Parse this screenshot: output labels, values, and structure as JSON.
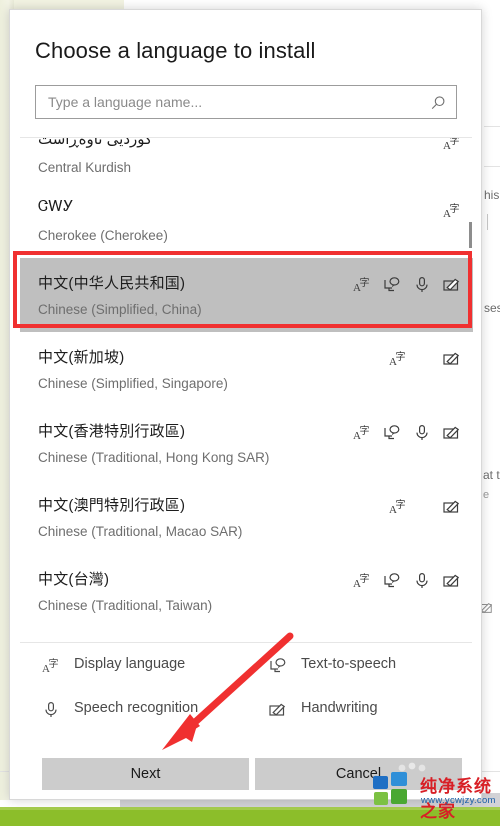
{
  "dialog": {
    "title": "Choose a language to install",
    "search": {
      "placeholder": "Type a language name...",
      "value": "",
      "icon": "search-icon"
    },
    "buttons": {
      "next": "Next",
      "cancel": "Cancel"
    }
  },
  "list": {
    "items": [
      {
        "native": "کوردیی ناوەڕاست",
        "english": "Central Kurdish",
        "features": [
          "display"
        ],
        "selected": false,
        "clipped": true
      },
      {
        "native": "ᏣᎳᎩ",
        "english": "Cherokee (Cherokee)",
        "features": [
          "display"
        ],
        "selected": false,
        "clipped": false
      },
      {
        "native": "中文(中华人民共和国)",
        "english": "Chinese (Simplified, China)",
        "features": [
          "display",
          "tts",
          "speech",
          "handwriting"
        ],
        "selected": true,
        "clipped": false
      },
      {
        "native": "中文(新加坡)",
        "english": "Chinese (Simplified, Singapore)",
        "features": [
          "display",
          "handwriting"
        ],
        "selected": false,
        "clipped": false
      },
      {
        "native": "中文(香港特別行政區)",
        "english": "Chinese (Traditional, Hong Kong SAR)",
        "features": [
          "display",
          "tts",
          "speech",
          "handwriting"
        ],
        "selected": false,
        "clipped": false
      },
      {
        "native": "中文(澳門特別行政區)",
        "english": "Chinese (Traditional, Macao SAR)",
        "features": [
          "display",
          "handwriting"
        ],
        "selected": false,
        "clipped": false
      },
      {
        "native": "中文(台灣)",
        "english": "Chinese (Traditional, Taiwan)",
        "features": [
          "display",
          "tts",
          "speech",
          "handwriting"
        ],
        "selected": false,
        "clipped": false
      }
    ]
  },
  "legend": {
    "display": "Display language",
    "tts": "Text-to-speech",
    "speech": "Speech recognition",
    "handwriting": "Handwriting"
  },
  "background_text": {
    "frag1": "his",
    "frag2": "ses",
    "frag3": "at t",
    "frag4": "e"
  },
  "watermark": {
    "name": "纯净系统之家",
    "url": "www.ycwjzy.com"
  },
  "colors": {
    "selection_gray": "#bfbfbf",
    "annotation_red": "#f03030",
    "button_gray": "#cccccc",
    "accent_green": "#8cbe2a",
    "watermark_red": "#d81f26",
    "watermark_blue": "#1b5fa8"
  }
}
